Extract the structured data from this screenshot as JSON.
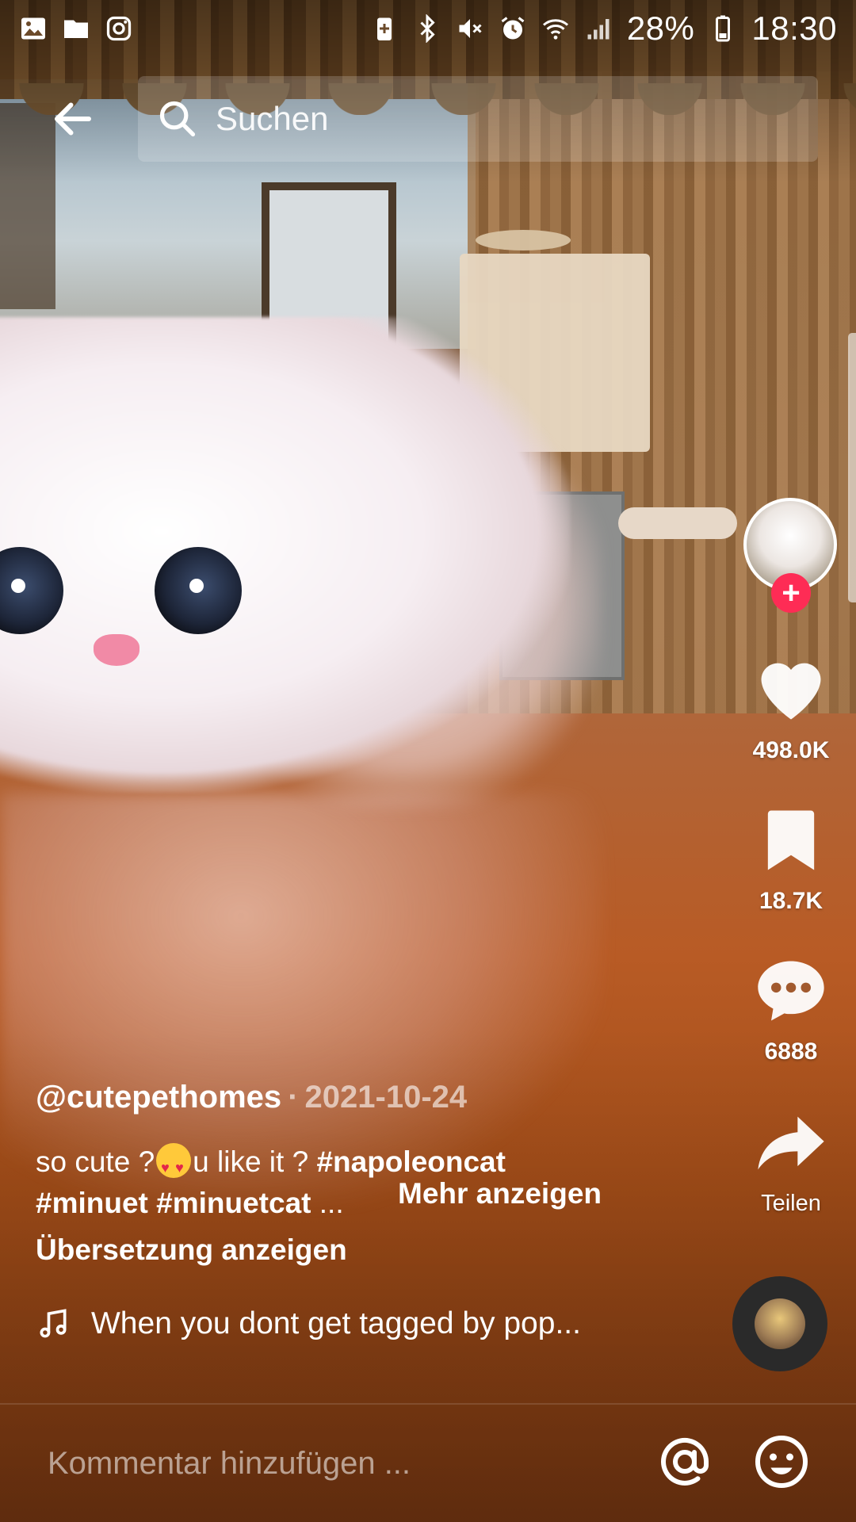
{
  "status_bar": {
    "battery_percent": "28%",
    "time": "18:30",
    "left_icons": [
      "gallery-icon",
      "folder-icon",
      "instagram-icon"
    ],
    "right_icons": [
      "battery-saver-icon",
      "bluetooth-icon",
      "mute-icon",
      "alarm-icon",
      "wifi-icon",
      "signal-icon",
      "battery-icon"
    ]
  },
  "header": {
    "search_placeholder": "Suchen"
  },
  "actions": {
    "likes": "498.0K",
    "saves": "18.7K",
    "comments": "6888",
    "share_label": "Teilen"
  },
  "post": {
    "username": "@cutepethomes",
    "separator": "·",
    "date": "2021-10-24",
    "caption_part1": "so cute ?",
    "caption_part2": "u like it ? ",
    "tag1": "#napoleoncat",
    "tag2": "#minuet",
    "tag3": "#minuetcat",
    "ellipsis": " ...",
    "more_label": "Mehr anzeigen",
    "translate_label": "Übersetzung anzeigen"
  },
  "music": {
    "title": "When you dont get tagged by pop..."
  },
  "comment_bar": {
    "placeholder": "Kommentar hinzufügen ..."
  },
  "colors": {
    "accent": "#fe2c55",
    "text": "#ffffff"
  }
}
